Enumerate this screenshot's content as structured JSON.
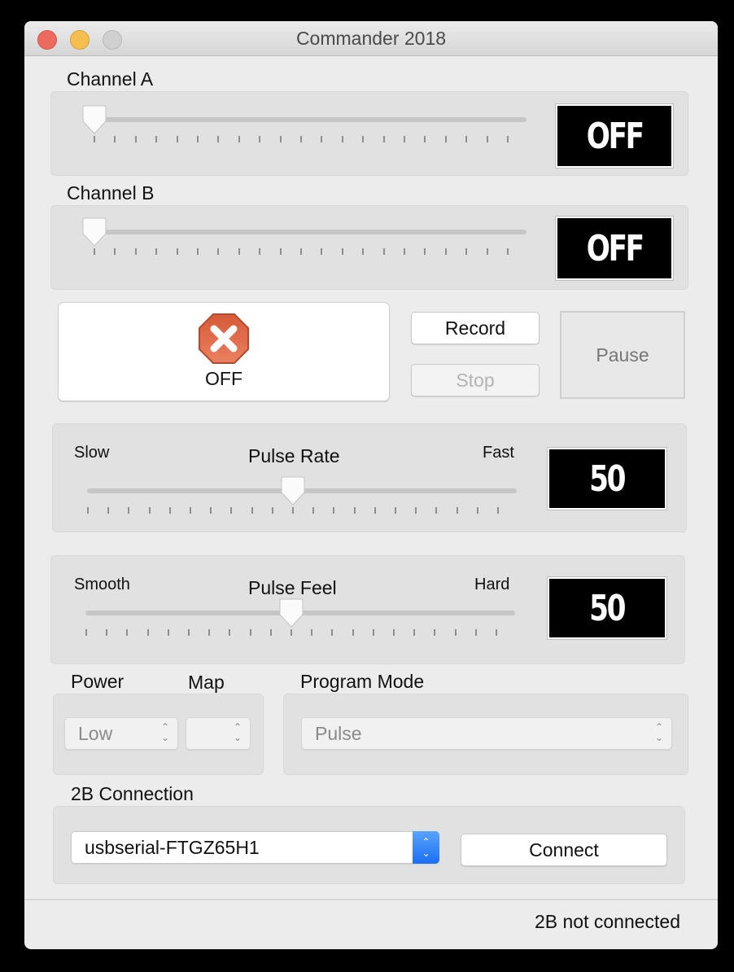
{
  "window": {
    "title": "Commander 2018"
  },
  "channel_a": {
    "label": "Channel A",
    "level_fraction": 0.0,
    "display": "OFF"
  },
  "channel_b": {
    "label": "Channel B",
    "level_fraction": 0.0,
    "display": "OFF"
  },
  "power_toggle": {
    "label": "OFF",
    "icon": "stop-x-icon",
    "icon_color": "#e06a4c"
  },
  "record": {
    "record_label": "Record",
    "stop_label": "Stop",
    "pause_label": "Pause"
  },
  "pulse_rate": {
    "title": "Pulse Rate",
    "min_label": "Slow",
    "max_label": "Fast",
    "value": 50,
    "display": "50",
    "max": 100
  },
  "pulse_feel": {
    "title": "Pulse Feel",
    "min_label": "Smooth",
    "max_label": "Hard",
    "value": 50,
    "display": "50",
    "max": 100
  },
  "power": {
    "label": "Power",
    "selected": "Low"
  },
  "map": {
    "label": "Map",
    "selected": ""
  },
  "program_mode": {
    "label": "Program Mode",
    "selected": "Pulse"
  },
  "connection": {
    "label": "2B Connection",
    "port": "usbserial-FTGZ65H1",
    "connect_label": "Connect",
    "accent": "#1b6ff5"
  },
  "status": {
    "text": "2B not connected"
  }
}
